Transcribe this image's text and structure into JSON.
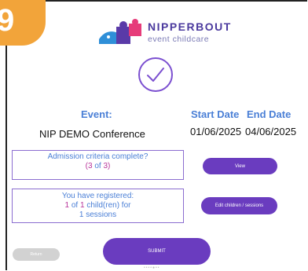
{
  "step_badge": "9",
  "brand": {
    "name": "NIPPERBOUT",
    "tagline": "event childcare"
  },
  "event": {
    "event_label": "Event:",
    "event_value": "NIP DEMO Conference",
    "start_label": "Start Date",
    "start_value": "01/06/2025",
    "end_label": "End Date",
    "end_value": "04/06/2025"
  },
  "admission": {
    "line1": "Admission criteria complete?",
    "open": "(",
    "done": "3",
    "of": " of ",
    "total": "3",
    "close": ")"
  },
  "registered": {
    "line1": "You have registered:",
    "count": "1",
    "of": " of ",
    "total": "1",
    "suffix": " child(ren) for",
    "sessions": "1 sessions"
  },
  "buttons": {
    "view": "View",
    "edit": "Edit children / sessions",
    "submit": "SUBMIT",
    "return": "Return"
  },
  "page_dots": "••••●••",
  "colors": {
    "accent": "#6a3cbf",
    "label_blue": "#4a7fd6",
    "badge": "#f2a43a",
    "highlight": "#b8339a"
  }
}
